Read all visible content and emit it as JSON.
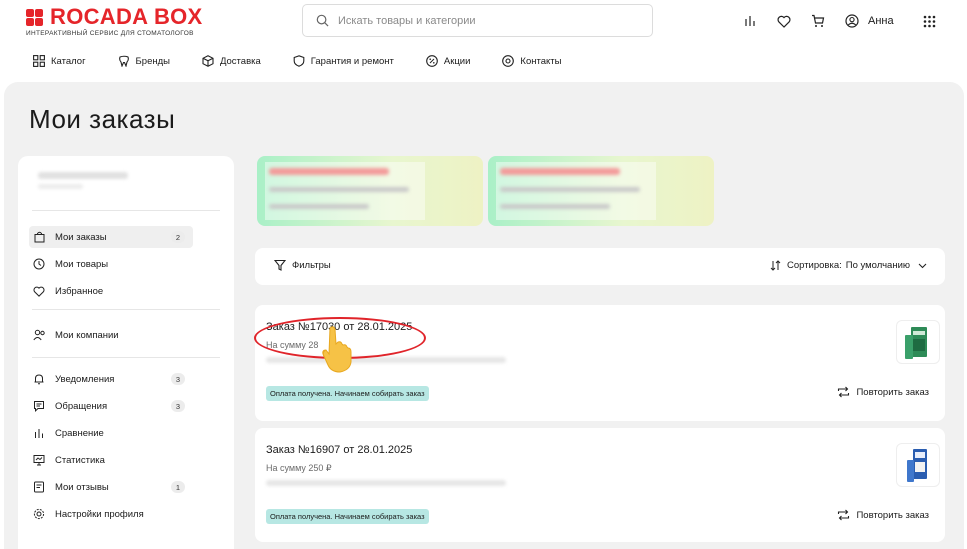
{
  "brand": {
    "name": "ROCADA BOX",
    "tagline": "ИНТЕРАКТИВНЫЙ СЕРВИС ДЛЯ СТОМАТОЛОГОВ",
    "color": "#e5252a"
  },
  "search": {
    "placeholder": "Искать товары и категории"
  },
  "header": {
    "user_name": "Анна",
    "icons": [
      "stats-icon",
      "heart-icon",
      "cart-icon",
      "user-icon",
      "apps-grid-icon"
    ]
  },
  "nav": {
    "items": [
      {
        "label": "Каталог",
        "icon": "grid-icon"
      },
      {
        "label": "Бренды",
        "icon": "tooth-icon"
      },
      {
        "label": "Доставка",
        "icon": "box-icon"
      },
      {
        "label": "Гарантия и ремонт",
        "icon": "shield-icon"
      },
      {
        "label": "Акции",
        "icon": "percent-icon"
      },
      {
        "label": "Контакты",
        "icon": "location-icon"
      }
    ]
  },
  "page": {
    "title": "Мои заказы"
  },
  "sidebar": {
    "items": [
      {
        "label": "Мои заказы",
        "badge": "2",
        "icon": "bag-icon",
        "active": true
      },
      {
        "label": "Мои товары",
        "badge": "",
        "icon": "history-icon"
      },
      {
        "label": "Избранное",
        "badge": "",
        "icon": "heart-icon"
      },
      {
        "label": "Мои компании",
        "badge": "",
        "icon": "people-icon"
      },
      {
        "label": "Уведомления",
        "badge": "3",
        "icon": "bell-icon"
      },
      {
        "label": "Обращения",
        "badge": "3",
        "icon": "chat-icon"
      },
      {
        "label": "Сравнение",
        "badge": "",
        "icon": "bars-icon"
      },
      {
        "label": "Статистика",
        "badge": "",
        "icon": "monitor-icon"
      },
      {
        "label": "Мои отзывы",
        "badge": "1",
        "icon": "review-icon"
      },
      {
        "label": "Настройки профиля",
        "badge": "",
        "icon": "gear-icon"
      }
    ]
  },
  "filters": {
    "label": "Фильтры",
    "sort_label": "Сортировка:",
    "sort_value": "По умолчанию"
  },
  "orders": [
    {
      "title": "Заказ №17030 от 28.01.2025",
      "sum": "На сумму 28",
      "status": "Оплата получена. Начинаем собирать заказ",
      "repeat_label": "Повторить заказ",
      "thumb_color": "#2e8b57"
    },
    {
      "title": "Заказ №16907 от 28.01.2025",
      "sum": "На сумму 250 ₽",
      "status": "Оплата получена. Начинаем собирать заказ",
      "repeat_label": "Повторить заказ",
      "thumb_color": "#2a5db0"
    }
  ],
  "colors": {
    "status_badge": "#b7e7e3",
    "annotation": "#e0242a",
    "delivery_gradient_start": "#a9f0c7",
    "background": "#f1f1f1"
  }
}
